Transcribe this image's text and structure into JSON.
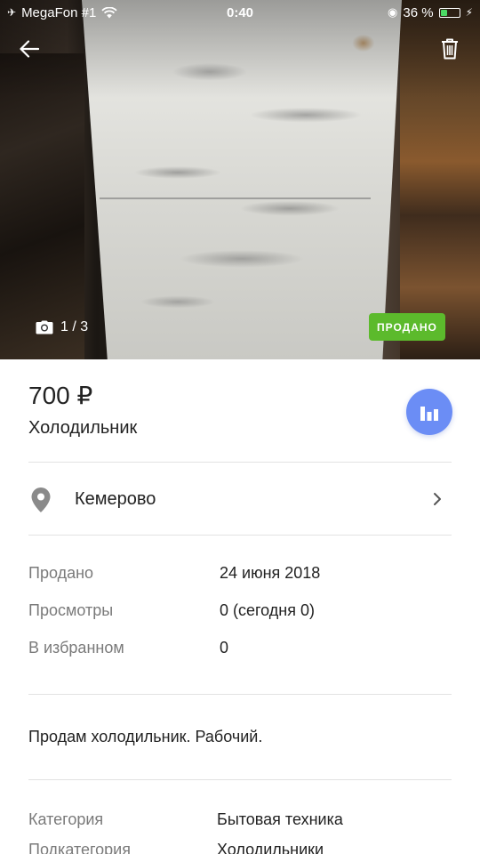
{
  "status_bar": {
    "carrier": "MegaFon #1",
    "time": "0:40",
    "battery_percent": "36 %",
    "battery_level": 0.36
  },
  "photo": {
    "counter": "1 / 3",
    "sold_badge": "ПРОДАНО"
  },
  "listing": {
    "price": "700 ₽",
    "title": "Холодильник",
    "location": "Кемерово",
    "details": [
      {
        "label": "Продано",
        "value": "24 июня 2018"
      },
      {
        "label": "Просмотры",
        "value": "0 (сегодня 0)"
      },
      {
        "label": "В избранном",
        "value": "0"
      }
    ],
    "description": "Продам холодильник. Рабочий.",
    "category_rows": [
      {
        "label": "Категория",
        "value": "Бытовая техника"
      },
      {
        "label": "Подкатегория",
        "value": "Холодильники"
      }
    ]
  },
  "colors": {
    "sold_badge": "#5cba2c",
    "stats_button": "#6b8df5",
    "muted_text": "#7a7a7a"
  },
  "icons": {
    "back": "arrow-left-icon",
    "trash": "trash-icon",
    "camera": "camera-icon",
    "stats": "bar-chart-icon",
    "location": "location-pin-icon",
    "chevron": "chevron-right-icon"
  }
}
